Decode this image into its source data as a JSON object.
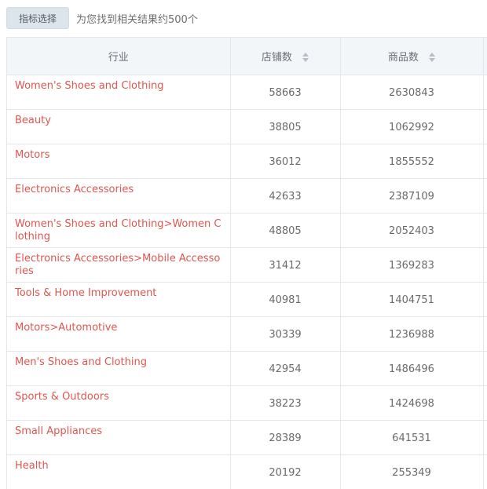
{
  "toolbar": {
    "filter_button_label": "指标选择",
    "result_text": "为您找到相关结果约500个"
  },
  "table": {
    "columns": [
      "行业",
      "店铺数",
      "商品数"
    ],
    "sortable_icon": "sort-arrows-icon",
    "rows": [
      {
        "industry": "Women's Shoes and Clothing",
        "shops": "58663",
        "products": "2630843"
      },
      {
        "industry": "Beauty",
        "shops": "38805",
        "products": "1062992"
      },
      {
        "industry": "Motors",
        "shops": "36012",
        "products": "1855552"
      },
      {
        "industry": "Electronics Accessories",
        "shops": "42633",
        "products": "2387109"
      },
      {
        "industry": "Women's Shoes and Clothing>Women Clothing",
        "shops": "48805",
        "products": "2052403"
      },
      {
        "industry": "Electronics Accessories>Mobile Accessories",
        "shops": "31412",
        "products": "1369283"
      },
      {
        "industry": "Tools & Home Improvement",
        "shops": "40981",
        "products": "1404751"
      },
      {
        "industry": "Motors>Automotive",
        "shops": "30339",
        "products": "1236988"
      },
      {
        "industry": "Men's Shoes and Clothing",
        "shops": "42954",
        "products": "1486496"
      },
      {
        "industry": "Sports & Outdoors",
        "shops": "38223",
        "products": "1424698"
      },
      {
        "industry": "Small Appliances",
        "shops": "28389",
        "products": "641531"
      },
      {
        "industry": "Health",
        "shops": "20192",
        "products": "255349"
      }
    ]
  },
  "colors": {
    "link": "#e0564f",
    "header_bg": "#f3f6f9",
    "border": "#e3e6ea",
    "button_bg": "#dde5ec"
  }
}
